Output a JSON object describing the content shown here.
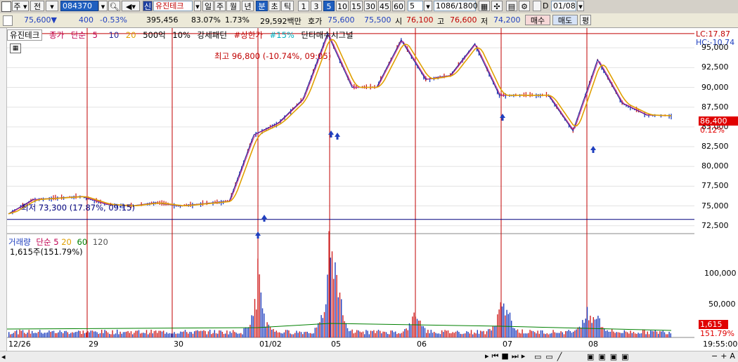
{
  "toolbar": {
    "period_label": "주",
    "prev_label": "전",
    "code": "084370",
    "stock_flag": "신",
    "stock_name": "유진테크",
    "period_buttons": [
      "일",
      "주",
      "월",
      "년",
      "분",
      "초",
      "틱"
    ],
    "minute_options": [
      "1",
      "3",
      "5",
      "10",
      "15",
      "30",
      "45",
      "60"
    ],
    "interval_value": "5",
    "count": "1086/1800",
    "date": "01/08"
  },
  "quote": {
    "price": "75,600",
    "arrow": "▼",
    "change": "400",
    "change_pct": "-0.53%",
    "volume": "395,456",
    "volume_ratio": "83.07%",
    "turnover": "1.73%",
    "amount": "29,592백만",
    "ask_label": "호가",
    "ask": "75,600",
    "bid": "75,500",
    "open_label": "시",
    "open": "76,100",
    "high_label": "고",
    "high": "76,600",
    "low_label": "저",
    "low": "74,200",
    "buy_button": "매수",
    "sell_button": "매도",
    "eval_button": "평"
  },
  "legend": {
    "name": "유진테크",
    "close": "종가",
    "ma_type": "단순",
    "ma5": "5",
    "ma10": "10",
    "ma20": "20",
    "bar_500": "500억",
    "pct10": "10%",
    "strong": "강세패턴",
    "limit_up": "#상한가",
    "pct15": "#15%",
    "signal": "단타매수시그널"
  },
  "price_panel": {
    "high_note": "최고 96,800 (-10.74%, 09:05)",
    "low_note": "최저 73,300 (17.87%, 09:15)",
    "lc": "LC:17.87",
    "hc": "HC:-10.74",
    "current_price": "86,400",
    "current_pct": "0.12%",
    "y_ticks": [
      "95,000",
      "92,500",
      "90,000",
      "87,500",
      "85,000",
      "82,500",
      "80,000",
      "77,500",
      "75,000",
      "72,500"
    ]
  },
  "volume_panel": {
    "title": "거래량",
    "ma_type": "단순",
    "ma5": "5",
    "ma20": "20",
    "ma60": "60",
    "ma120": "120",
    "current": "1,615주(151.79%)",
    "y_ticks": [
      "100,000",
      "50,000"
    ],
    "badge_value": "1,615",
    "badge_pct": "151.79%"
  },
  "x_axis": {
    "labels": [
      "12/26",
      "29",
      "30",
      "01/02",
      "05",
      "06",
      "07",
      "08"
    ],
    "time": "19:55:00"
  },
  "colors": {
    "candle": "#1f3fbf",
    "ma5": "#cc2a8a",
    "ma10": "#2b2b9a",
    "ma20": "#e0a000",
    "session_line": "#c00000",
    "low_line": "#00007f",
    "high_line": "#c00000",
    "price_badge": "#e00000"
  },
  "chart_data": {
    "type": "line",
    "x_sessions": [
      "12/26",
      "29",
      "30",
      "01/02",
      "05",
      "06",
      "07",
      "08"
    ],
    "series": [
      {
        "values": [
          74000,
          75800,
          76000,
          76200,
          75200,
          75000,
          75400,
          75000,
          75300,
          75600,
          84000,
          85500,
          88500,
          96800,
          90000,
          90000,
          96000,
          91000,
          91500,
          95500,
          89000,
          89000,
          89000,
          84500,
          93500,
          88000,
          86500,
          86400
        ]
      }
    ],
    "ylim": [
      71500,
      97500
    ],
    "high": 96800,
    "low": 73300,
    "volume_ylim": [
      0,
      130000
    ]
  }
}
